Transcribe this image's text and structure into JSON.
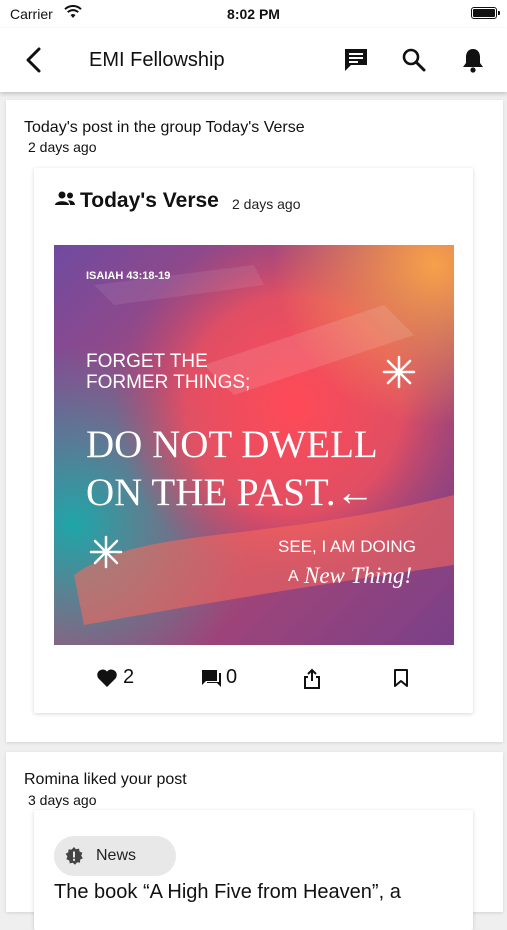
{
  "status": {
    "carrier": "Carrier",
    "time": "8:02 PM"
  },
  "appbar": {
    "title": "EMI Fellowship"
  },
  "feed": [
    {
      "headline": "Today's post in the group Today's Verse",
      "time": "2 days ago",
      "post": {
        "group": "Today's Verse",
        "time": "2 days ago",
        "image_text": {
          "ref": "ISAIAH 43:18-19",
          "line1": "FORGET THE",
          "line2": "FORMER THINGS;",
          "big1": "DO NOT DWELL",
          "big2": "ON THE PAST.←",
          "small1": "SEE, I AM DOING",
          "small2a": "A",
          "small2b": "New Thing!"
        },
        "likes": "2",
        "comments": "0"
      }
    },
    {
      "headline": "Romina  liked your post",
      "time": "3 days ago",
      "post": {
        "tag": "News",
        "body": "The book “A High Five from Heaven”, a"
      }
    }
  ],
  "colors": {
    "accent": "#111111"
  }
}
